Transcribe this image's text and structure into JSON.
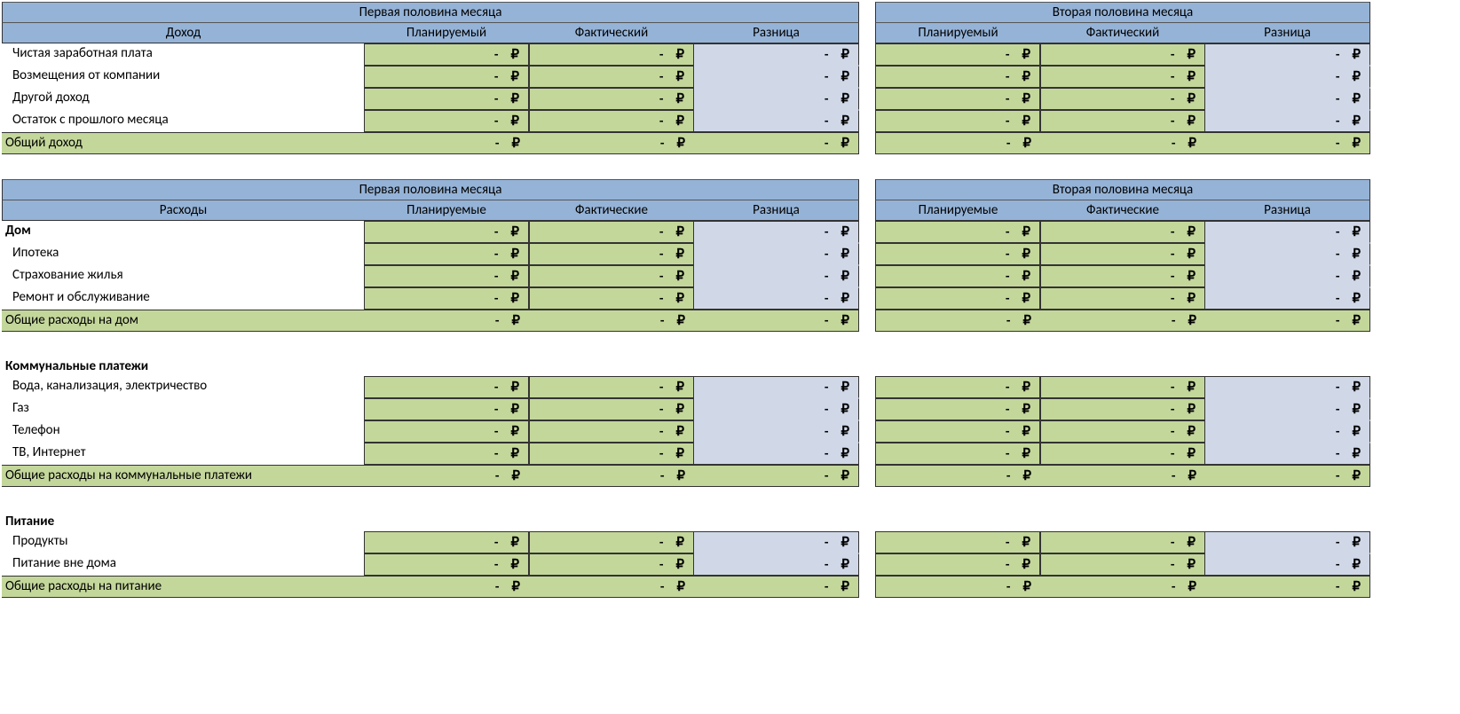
{
  "currency": "₽",
  "dash": "-",
  "periods": {
    "first": "Первая половина месяца",
    "second": "Вторая половина месяца"
  },
  "income": {
    "title": "Доход",
    "cols": {
      "plan": "Планируемый",
      "fact": "Фактический",
      "diff": "Разница"
    },
    "rows": [
      "Чистая заработная плата",
      "Возмещения от компании",
      "Другой доход",
      "Остаток с прошлого месяца"
    ],
    "total": "Общий доход"
  },
  "expenses": {
    "title": "Расходы",
    "cols": {
      "plan": "Планируемые",
      "fact": "Фактические",
      "diff": "Разница"
    },
    "groups": [
      {
        "name": "Дом",
        "has_header_values": true,
        "rows": [
          "Ипотека",
          "Страхование жилья",
          "Ремонт и обслуживание"
        ],
        "total": "Общие расходы на дом"
      },
      {
        "name": "Коммунальные платежи",
        "has_header_values": false,
        "rows": [
          "Вода, канализация, электричество",
          "Газ",
          "Телефон",
          "ТВ, Интернет"
        ],
        "total": "Общие расходы на коммунальные платежи"
      },
      {
        "name": "Питание",
        "has_header_values": false,
        "rows": [
          "Продукты",
          "Питание вне дома"
        ],
        "total": "Общие расходы на питание"
      }
    ]
  }
}
